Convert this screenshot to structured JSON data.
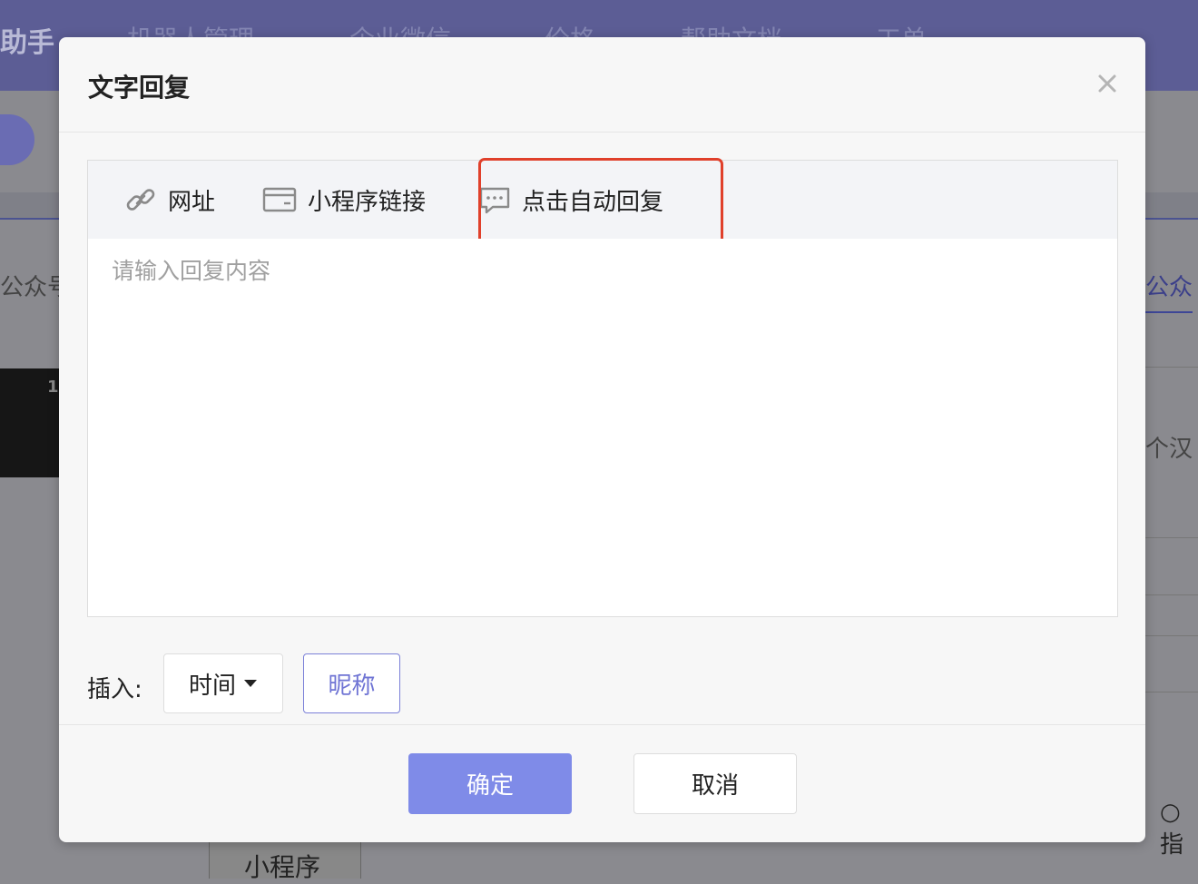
{
  "background": {
    "brand": "助手",
    "nav": [
      "机器人管理",
      "企业微信",
      "价格",
      "帮助文档",
      "工单"
    ],
    "left_text": "公众号",
    "right_text": "公众",
    "dark_label": "1",
    "right_text2": "个汉",
    "radio_text": "○指",
    "bottom_tab": "小程序"
  },
  "modal": {
    "title": "文字回复",
    "toolbar": {
      "link": {
        "label": "网址",
        "icon": "link-icon"
      },
      "miniprogram": {
        "label": "小程序链接",
        "icon": "card-icon"
      },
      "auto_reply": {
        "label": "点击自动回复",
        "icon": "chat-bubble-icon"
      }
    },
    "reply_placeholder": "请输入回复内容",
    "reply_value": "",
    "insert_label": "插入:",
    "time_select": "时间",
    "nickname_button": "昵称",
    "ok_button": "确定",
    "cancel_button": "取消"
  },
  "colors": {
    "primary": "#7f8be8",
    "highlight": "#e0402b",
    "nav_bg": "#5c5d95"
  }
}
